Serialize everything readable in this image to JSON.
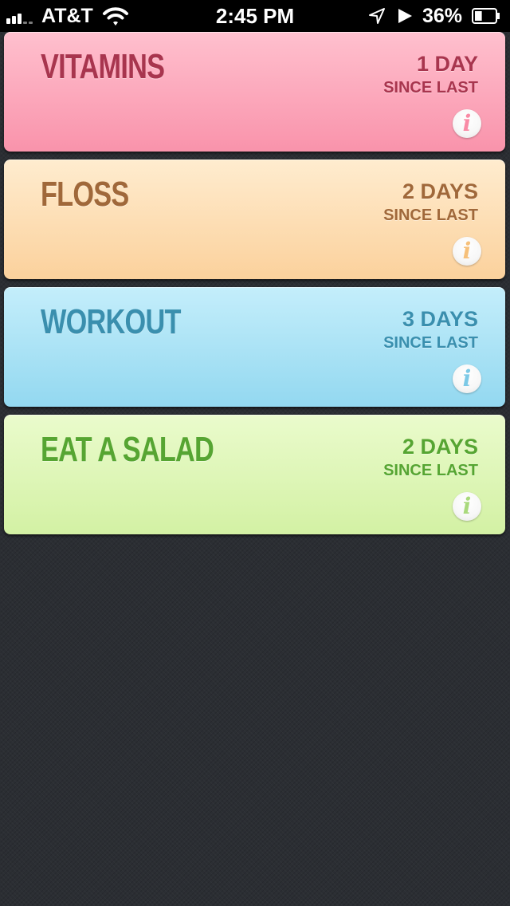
{
  "status_bar": {
    "carrier": "AT&T",
    "time": "2:45 PM",
    "battery_percent": "36%",
    "signal_bars": 3,
    "battery_level": 0.36,
    "icons": [
      "signal-icon",
      "wifi-icon",
      "location-arrow-icon",
      "play-icon",
      "battery-icon"
    ]
  },
  "cards": [
    {
      "title": "VITAMINS",
      "count": "1 DAY",
      "since": "SINCE LAST",
      "info_glyph": "i",
      "icon": "info-icon",
      "text_color": "#a8354e",
      "icon_color": "#f98aa5"
    },
    {
      "title": "FLOSS",
      "count": "2 DAYS",
      "since": "SINCE LAST",
      "info_glyph": "i",
      "icon": "info-icon",
      "text_color": "#a0683a",
      "icon_color": "#f6c07a"
    },
    {
      "title": "WORKOUT",
      "count": "3 DAYS",
      "since": "SINCE LAST",
      "info_glyph": "i",
      "icon": "info-icon",
      "text_color": "#3a8fae",
      "icon_color": "#7cc9e6"
    },
    {
      "title": "EAT A SALAD",
      "count": "2 DAYS",
      "since": "SINCE LAST",
      "info_glyph": "i",
      "icon": "info-icon",
      "text_color": "#56a532",
      "icon_color": "#a9d97c"
    }
  ]
}
